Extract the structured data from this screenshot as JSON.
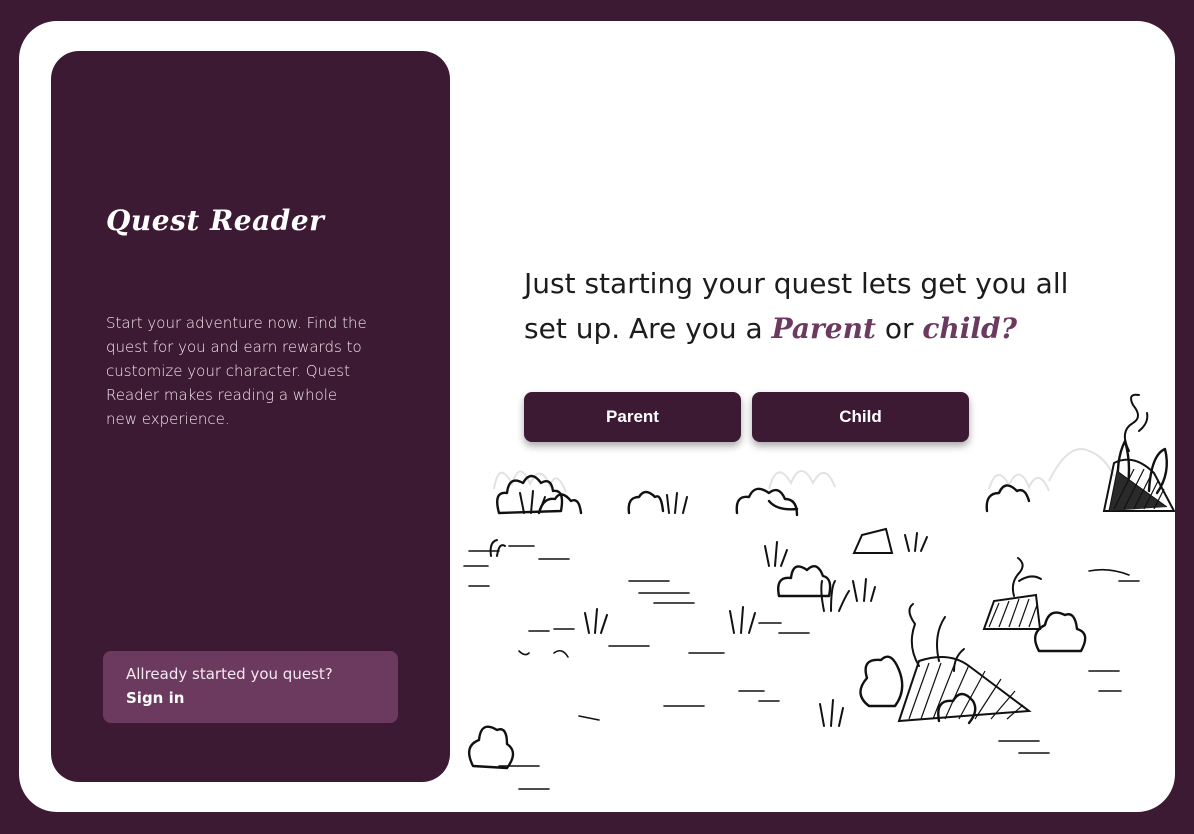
{
  "app": {
    "title": "Quest Reader",
    "intro": "Start your adventure now. Find the quest for you and earn rewards to customize your character. Quest Reader makes reading a whole new experience."
  },
  "signin": {
    "prompt": "Allready started you quest?",
    "link_label": "Sign in"
  },
  "question": {
    "text_start": "Just starting your quest lets get you all set up. Are you a ",
    "parent_word": "Parent",
    "connector": " or ",
    "child_word": "child",
    "question_mark": "?"
  },
  "buttons": {
    "parent_label": "Parent",
    "child_label": "Child"
  },
  "colors": {
    "brand_dark": "#3c1a33",
    "accent": "#6d3a5f",
    "background": "#ffffff"
  },
  "illustration": {
    "name": "sketched-grassland-illustration"
  }
}
